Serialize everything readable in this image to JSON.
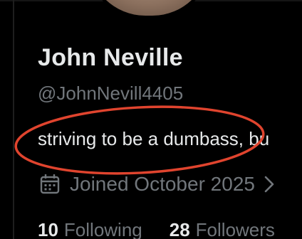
{
  "profile": {
    "name": "John Neville",
    "handle": "@JohnNevill4405",
    "bio": "striving to be a dumbass, bu",
    "joined": "Joined October 2025"
  },
  "stats": {
    "following_count": "10",
    "following_label": "Following",
    "followers_count": "28",
    "followers_label": "Followers"
  },
  "icons": {
    "calendar": "calendar-icon",
    "chevron": "chevron-right-icon"
  },
  "colors": {
    "background": "#000000",
    "primary_text": "#e7e9ea",
    "secondary_text": "#71767b",
    "annotation": "#e0442e"
  }
}
